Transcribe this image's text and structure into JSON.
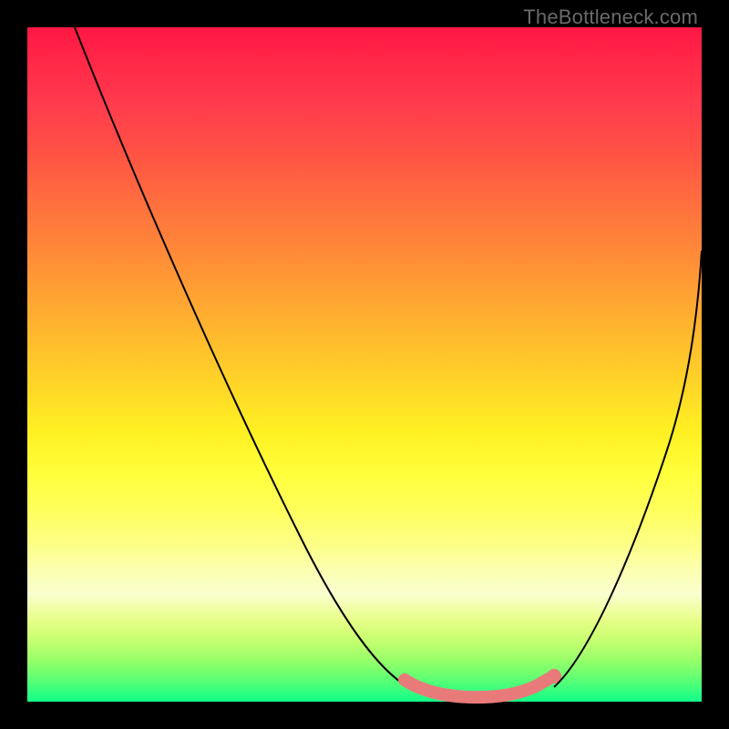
{
  "watermark": "TheBottleneck.com",
  "chart_data": {
    "type": "line",
    "title": "",
    "xlabel": "",
    "ylabel": "",
    "xlim": [
      0,
      100
    ],
    "ylim": [
      0,
      100
    ],
    "grid": false,
    "legend": false,
    "series": [
      {
        "name": "left-curve",
        "x": [
          7,
          10,
          15,
          20,
          25,
          30,
          35,
          40,
          45,
          50,
          53,
          56,
          58
        ],
        "y": [
          100,
          94,
          83,
          72,
          61,
          50,
          40,
          30,
          20,
          11,
          6,
          3,
          1.5
        ]
      },
      {
        "name": "right-curve",
        "x": [
          78,
          80,
          83,
          86,
          89,
          92,
          95,
          98,
          100
        ],
        "y": [
          2,
          4,
          9,
          16,
          25,
          35,
          46,
          58,
          67
        ]
      },
      {
        "name": "optimal-band",
        "x": [
          56,
          58,
          60,
          63,
          66,
          69,
          72,
          75,
          77
        ],
        "y": [
          3.2,
          1.8,
          1.1,
          0.6,
          0.5,
          0.6,
          1.0,
          1.6,
          2.4
        ]
      }
    ],
    "marker": {
      "x": 78,
      "y": 2.2
    },
    "colors": {
      "curve": "#000000",
      "band": "#e97a7a",
      "gradient_top": "#ff1744",
      "gradient_bottom": "#12ff8a"
    }
  }
}
